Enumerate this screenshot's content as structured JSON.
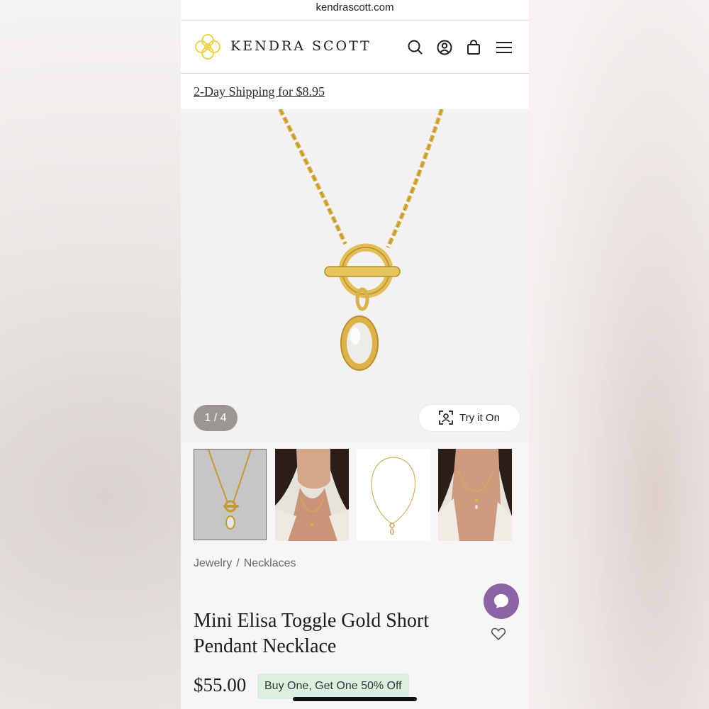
{
  "browser": {
    "url": "kendrascott.com"
  },
  "header": {
    "brand": "KENDRA SCOTT",
    "icons": [
      "search-icon",
      "account-icon",
      "bag-icon",
      "menu-icon"
    ]
  },
  "promo": {
    "text": "2-Day Shipping for $8.95"
  },
  "gallery": {
    "counter": "1 / 4",
    "try_on_label": "Try it On",
    "thumbnails": [
      "necklace-product-shot",
      "model-wearing-necklace",
      "necklace-flat-lay",
      "model-closeup"
    ],
    "selected_index": 0
  },
  "breadcrumb": {
    "items": [
      "Jewelry",
      "/",
      "Necklaces"
    ]
  },
  "product": {
    "title_line1": "Mini Elisa Toggle Gold Short",
    "title_line2": "Pendant Necklace",
    "price": "$55.00",
    "offer_badge": "Buy One, Get One 50% Off"
  },
  "colors": {
    "brand_gold": "#e9d64c",
    "chat_purple": "#8a64a4",
    "offer_green": "#dcefe1",
    "gold_metal": "#d9b24a"
  }
}
